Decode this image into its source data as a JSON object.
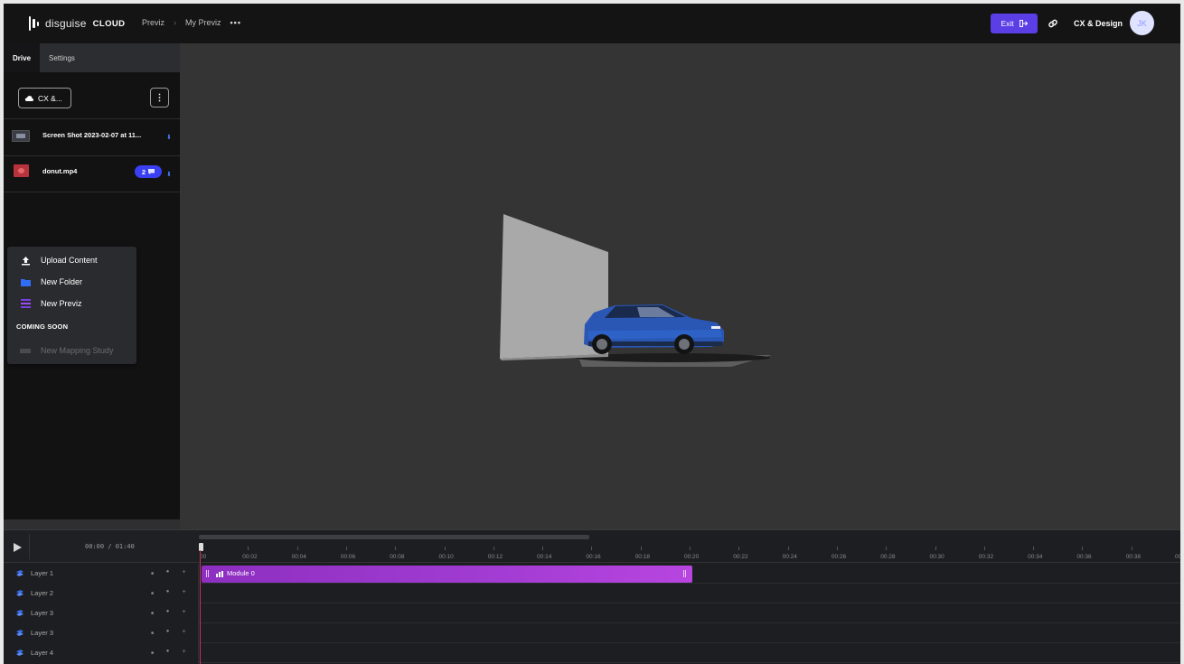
{
  "app": {
    "brand_word": "disguise",
    "brand_cloud": "CLOUD",
    "breadcrumb": [
      "Previz",
      "My Previz"
    ],
    "breadcrumb_more": "•••",
    "exit_label": "Exit",
    "org_name": "CX & Design",
    "avatar_initials": "JK",
    "accent_color": "#5b3ee6"
  },
  "sidebar": {
    "tabs": [
      {
        "label": "Drive",
        "active": true
      },
      {
        "label": "Settings",
        "active": false
      }
    ],
    "drive_button_label": "CX &...",
    "files": [
      {
        "name": "Screen Shot 2023-02-07 at 11...",
        "icon": "image-thumbnail",
        "comments": null
      },
      {
        "name": "donut.mp4",
        "icon": "video-thumbnail",
        "comments": "2"
      }
    ],
    "menu": {
      "items": [
        {
          "label": "Upload Content",
          "icon": "upload-icon",
          "enabled": true
        },
        {
          "label": "New Folder",
          "icon": "folder-icon",
          "enabled": true
        },
        {
          "label": "New Previz",
          "icon": "previz-icon",
          "enabled": true
        }
      ],
      "section_label": "COMING SOON",
      "coming_soon": [
        {
          "label": "New Mapping Study",
          "icon": "mapping-icon",
          "enabled": false
        }
      ]
    }
  },
  "timeline": {
    "time_readout": "00:00 / 01:40",
    "ticks": [
      "00",
      "00:02",
      "00:04",
      "00:06",
      "00:08",
      "00:10",
      "00:12",
      "00:14",
      "00:16",
      "00:18",
      "00:20",
      "00:22",
      "00:24",
      "00:26",
      "00:28",
      "00:30",
      "00:32",
      "00:34",
      "00:36",
      "00:38",
      "00"
    ],
    "layers": [
      {
        "name": "Layer 1"
      },
      {
        "name": "Layer 2"
      },
      {
        "name": "Layer 3"
      },
      {
        "name": "Layer 3"
      },
      {
        "name": "Layer 4"
      }
    ],
    "clip": {
      "label": "Module 0",
      "layer": "Layer 1",
      "start": "00:00",
      "end": "00:20",
      "color": "#9b37cc"
    }
  }
}
